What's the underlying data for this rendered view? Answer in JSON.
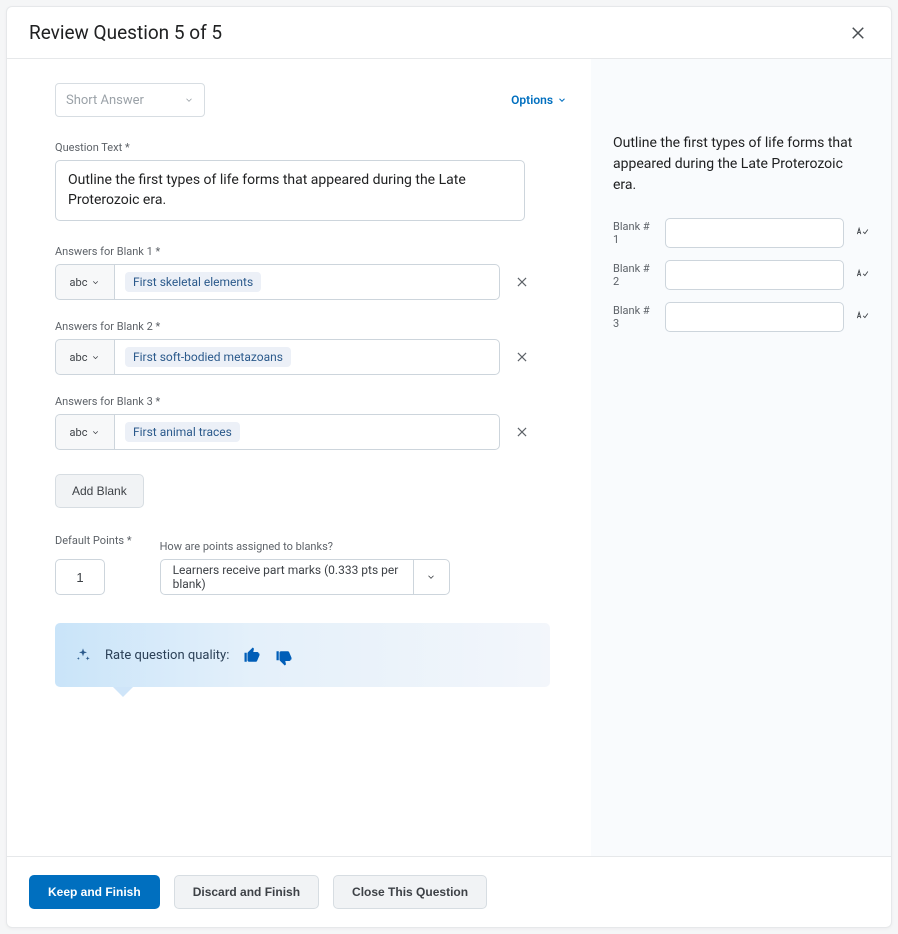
{
  "header": {
    "title": "Review Question 5 of 5"
  },
  "typeSelect": {
    "value": "Short Answer"
  },
  "optionsLabel": "Options",
  "questionTextLabel": "Question Text",
  "questionText": "Outline the first types of life forms that appeared during the Late Proterozoic era.",
  "blanks": [
    {
      "label": "Answers for Blank 1",
      "format": "abc",
      "answer": "First skeletal elements"
    },
    {
      "label": "Answers for Blank 2",
      "format": "abc",
      "answer": "First soft-bodied metazoans"
    },
    {
      "label": "Answers for Blank 3",
      "format": "abc",
      "answer": "First animal traces"
    }
  ],
  "addBlankLabel": "Add Blank",
  "points": {
    "defaultLabel": "Default Points",
    "ruleLabel": "How are points assigned to blanks?",
    "value": "1",
    "rule": "Learners receive part marks (0.333 pts per blank)"
  },
  "rate": {
    "label": "Rate question quality:"
  },
  "preview": {
    "text": "Outline the first types of life forms that appeared during the Late Proterozoic era.",
    "rows": [
      {
        "label": "Blank # 1"
      },
      {
        "label": "Blank # 2"
      },
      {
        "label": "Blank # 3"
      }
    ]
  },
  "footer": {
    "keep": "Keep and Finish",
    "discard": "Discard and Finish",
    "close": "Close This Question"
  }
}
